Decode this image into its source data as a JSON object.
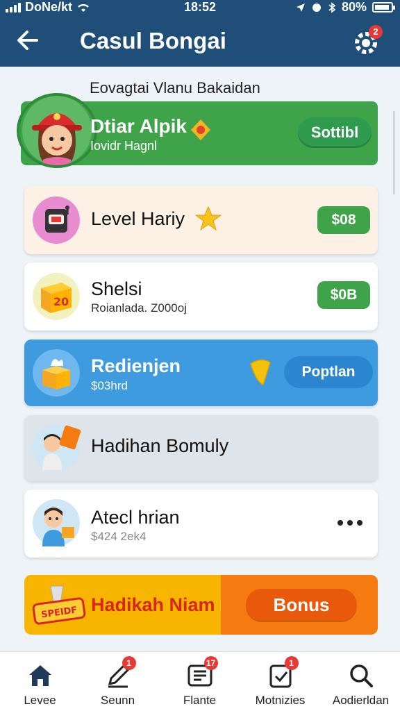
{
  "status_bar": {
    "carrier": "DoNe/kt",
    "time": "18:52",
    "battery": "80%"
  },
  "header": {
    "title": "Casul Bongai",
    "back_icon": "arrow-left-icon",
    "settings_icon": "gear-icon",
    "settings_badge": "2"
  },
  "section_label": "Eovagtai Vlanu Bakaidan",
  "hero": {
    "title": "Dtiar Alpik",
    "subtitle": "Iovidr Hagnl",
    "button": "Sottibl"
  },
  "cards": [
    {
      "title": "Level Hariy",
      "button": "$08"
    },
    {
      "title": "Shelsi",
      "subtitle": "Roianlada. Z000oj",
      "button": "$0B",
      "icon_text": "20"
    },
    {
      "title": "Redienjen",
      "subtitle": "$03hrd",
      "button": "Poptlan"
    },
    {
      "title": "Hadihan Bomuly"
    },
    {
      "title": "Atecl hrian",
      "subtitle": "$424 2ek4"
    }
  ],
  "bonus": {
    "title": "Hadikah Niam",
    "button": "Bonus",
    "badge": "SPEIDF"
  },
  "bottom_nav": [
    {
      "label": "Levee",
      "icon": "home-icon"
    },
    {
      "label": "Seunn",
      "icon": "pen-icon",
      "badge": "1"
    },
    {
      "label": "Flante",
      "icon": "list-icon",
      "badge": "17"
    },
    {
      "label": "Motnizies",
      "icon": "clipboard-check-icon",
      "badge": "1"
    },
    {
      "label": "Aodierldan",
      "icon": "search-icon"
    }
  ],
  "colors": {
    "header": "#1f4f79",
    "green": "#3fa34a",
    "blue": "#3f9be0",
    "orange": "#f57b10",
    "yellow": "#f7b500"
  }
}
